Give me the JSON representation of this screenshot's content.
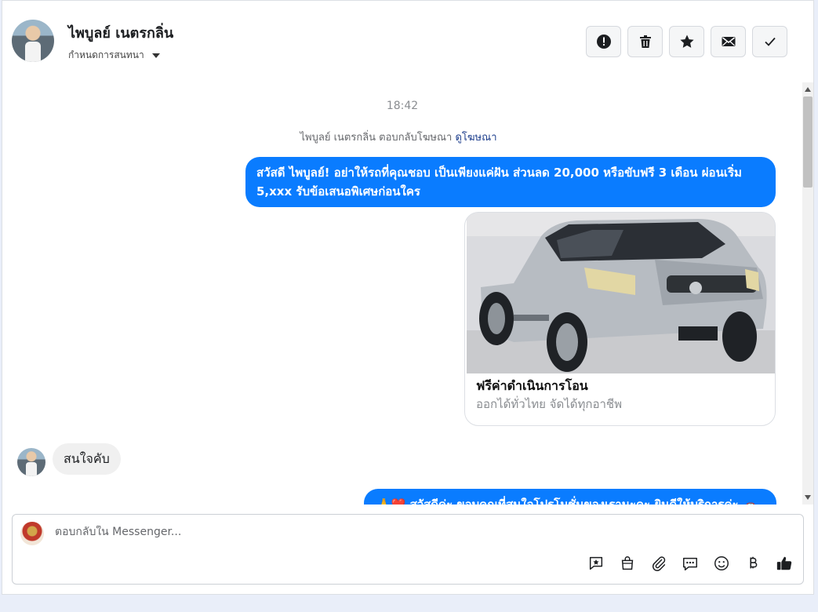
{
  "header": {
    "contact_name": "ไพบูลย์ เนตรกลิ่น",
    "assign_label": "กำหนดการสนทนา",
    "actions": {
      "spam": "mark-spam",
      "delete": "delete",
      "star": "star",
      "email": "mark-unread",
      "done": "mark-done"
    }
  },
  "chat": {
    "timestamp": "18:42",
    "replied_text": "ไพบูลย์ เนตรกลิ่น ตอบกลับโฆษณา",
    "replied_link": "ดูโฆษณา",
    "messages": [
      {
        "from": "page",
        "text": "สวัสดี ไพบูลย์! อย่าให้รถที่คุณชอบ เป็นเพียงแค่ฝัน ส่วนลด 20,000 หรือขับฟรี 3 เดือน ผ่อนเริ่ม 5,xxx รับข้อเสนอพิเศษก่อนใคร"
      },
      {
        "from": "user",
        "text": "สนใจคับ"
      },
      {
        "from": "page",
        "text": "🙏❤️ สวัสดีค่ะ ขอบคุณที่สนใจโปรโมชั่นของเรานะคะ ยินดีให้บริการค่ะ 🚗"
      }
    ],
    "ad_card": {
      "title": "ฟรีค่าดำเนินการโอน",
      "subtitle": "ออกได้ทั่วไทย จัดได้ทุกอาชีพ"
    }
  },
  "composer": {
    "placeholder": "ตอบกลับใน Messenger...",
    "value": "",
    "tools": [
      "saved-reply-icon",
      "shop-icon",
      "attachment-icon",
      "message-icon",
      "emoji-icon",
      "baht-icon",
      "like-icon"
    ]
  }
}
